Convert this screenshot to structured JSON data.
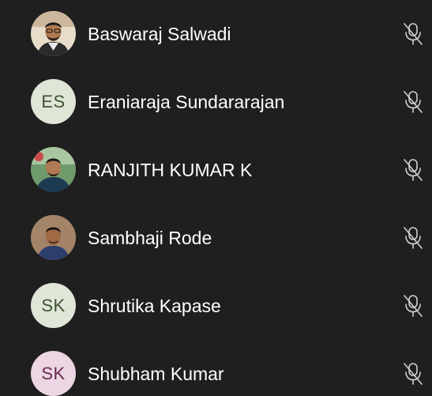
{
  "participants": [
    {
      "name": "Baswaraj Salwadi",
      "avatar_type": "photo",
      "initials": "",
      "avatar_bg": "#d9c7b0",
      "avatar_fg": "",
      "mic_icon": "mic-off-icon"
    },
    {
      "name": "Eraniaraja Sundararajan",
      "avatar_type": "initials",
      "initials": "ES",
      "avatar_bg": "#dfe6d8",
      "avatar_fg": "#3f5130",
      "mic_icon": "mic-off-icon"
    },
    {
      "name": "RANJITH KUMAR K",
      "avatar_type": "photo",
      "initials": "",
      "avatar_bg": "#4a7a5a",
      "avatar_fg": "",
      "mic_icon": "mic-off-icon"
    },
    {
      "name": "Sambhaji Rode",
      "avatar_type": "photo",
      "initials": "",
      "avatar_bg": "#8a6a52",
      "avatar_fg": "",
      "mic_icon": "mic-off-icon"
    },
    {
      "name": "Shrutika Kapase",
      "avatar_type": "initials",
      "initials": "SK",
      "avatar_bg": "#dfe6d8",
      "avatar_fg": "#3f5130",
      "mic_icon": "mic-off-icon"
    },
    {
      "name": "Shubham Kumar",
      "avatar_type": "initials",
      "initials": "SK",
      "avatar_bg": "#ecd6e3",
      "avatar_fg": "#6a2a4e",
      "mic_icon": "mic-off-icon"
    }
  ],
  "colors": {
    "background": "#1f1f1f",
    "name_text": "#ffffff",
    "mic_icon": "#d0d0d0"
  }
}
